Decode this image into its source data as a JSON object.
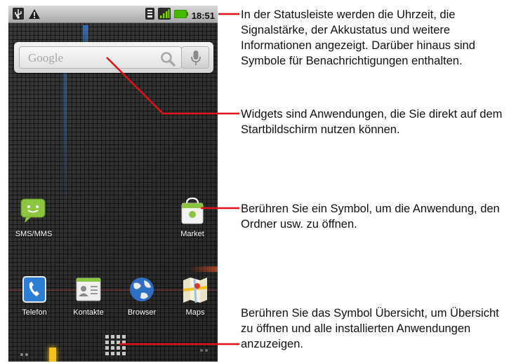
{
  "status_bar": {
    "clock": "18:51",
    "icons": [
      "usb-icon",
      "warning-icon",
      "wifi-icon",
      "signal-icon",
      "battery-icon"
    ]
  },
  "search_widget": {
    "placeholder": "Google",
    "icons": [
      "magnifier-icon",
      "microphone-icon"
    ]
  },
  "apps": [
    {
      "label": "SMS/MMS",
      "icon": "sms-icon"
    },
    {
      "label": "Market",
      "icon": "market-bag-icon"
    },
    {
      "label": "Telefon",
      "icon": "phone-icon"
    },
    {
      "label": "Kontakte",
      "icon": "contacts-icon"
    },
    {
      "label": "Browser",
      "icon": "globe-icon"
    },
    {
      "label": "Maps",
      "icon": "maps-icon"
    }
  ],
  "callouts": [
    "In der Statusleiste werden die Uhrzeit, die Signalstärke, der Akkustatus und weitere Informationen angezeigt. Darüber hinaus sind Symbole für Benachrichtigungen enthalten.",
    "Widgets sind Anwendungen, die Sie direkt auf dem Startbildschirm nutzen können.",
    "Berühren Sie ein Symbol, um die Anwendung, den Ordner usw. zu öffnen.",
    "Berühren Sie das Symbol Übersicht, um Übersicht zu öffnen und alle installierten Anwendungen anzuzeigen."
  ],
  "colors": {
    "callout_line": "#e0101c",
    "sms_green": "#8cc63f",
    "phone_blue": "#2a7fd4",
    "status_bar": "#c4c4c4",
    "battery_green": "#46b800"
  }
}
